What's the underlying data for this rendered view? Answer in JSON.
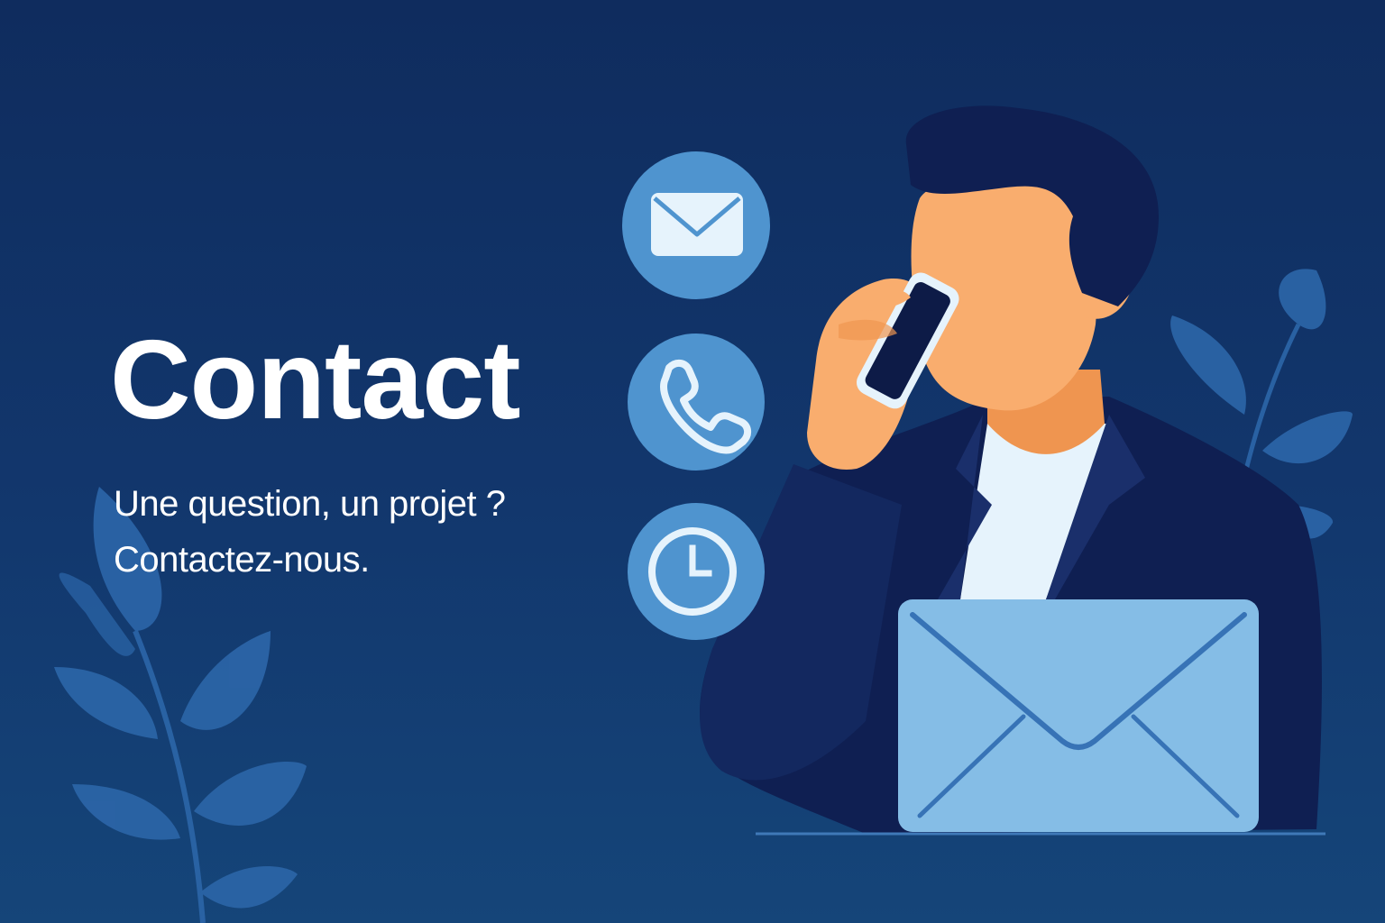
{
  "hero": {
    "title": "Contact",
    "subtitle_line1": "Une question, un projet ?",
    "subtitle_line2": "Contactez-nous."
  },
  "icons": [
    "mail-icon",
    "phone-icon",
    "clock-icon"
  ],
  "colors": {
    "background": "#12376d",
    "icon_circle": "#4f94cf",
    "skin": "#f9ad6e",
    "jacket": "#0f1f52",
    "envelope": "#85bde6",
    "leaf": "#2b64a6"
  }
}
